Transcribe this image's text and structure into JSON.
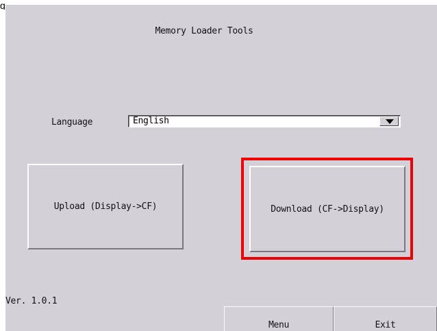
{
  "caption": "g",
  "screen": {
    "title": "Memory Loader Tools",
    "language": {
      "label": "Language",
      "selected": "English"
    },
    "upload_label": "Upload (Display->CF)",
    "download_label": "Download (CF->Display)",
    "highlight_color": "#ee0000",
    "version": "Ver. 1.0.1",
    "menu_label": "Menu",
    "exit_label": "Exit"
  }
}
